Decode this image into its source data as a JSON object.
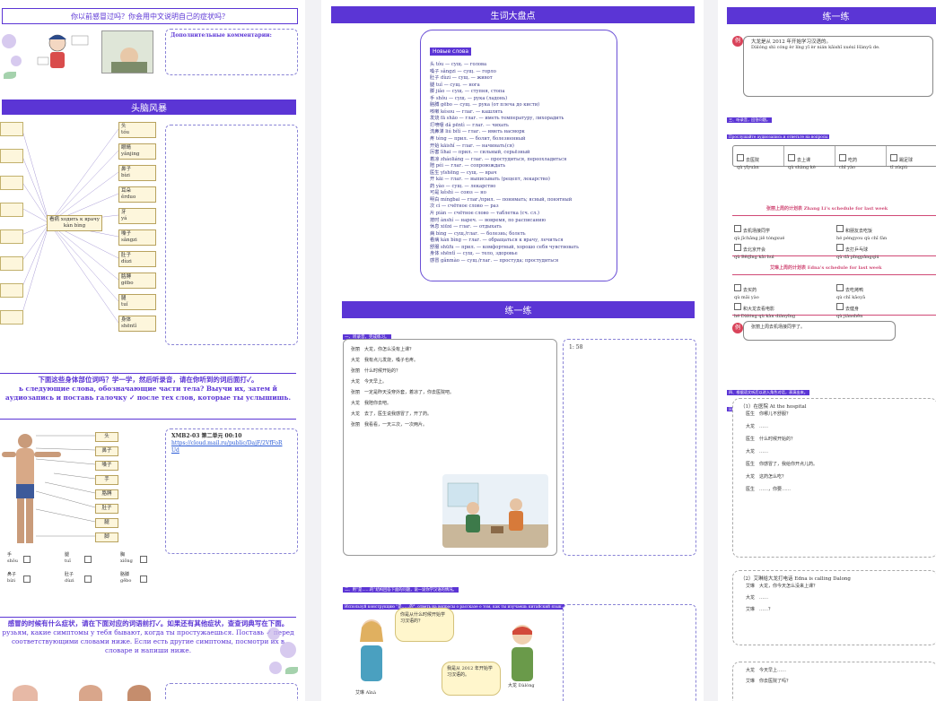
{
  "page1": {
    "question_heading": "你以前感冒过吗？你会用中文说明自己的症状吗？",
    "comments_label": "Дополнительные комментарии:",
    "brainstorm_heading": "头脑风暴",
    "center_label_cn": "看病 ходить к врачу",
    "center_label_py": "kàn bìng",
    "body_parts": [
      {
        "cn": "头",
        "py": "tóu"
      },
      {
        "cn": "眼睛",
        "py": "yǎnjing"
      },
      {
        "cn": "鼻子",
        "py": "bízi"
      },
      {
        "cn": "耳朵",
        "py": "ěrduo"
      },
      {
        "cn": "牙",
        "py": "yá"
      },
      {
        "cn": "嗓子",
        "py": "sǎngzi"
      },
      {
        "cn": "肚子",
        "py": "dùzi"
      },
      {
        "cn": "胳膊",
        "py": "gēbo"
      },
      {
        "cn": "腿",
        "py": "tuǐ"
      },
      {
        "cn": "身体",
        "py": "shēntǐ"
      }
    ],
    "task1_cn": "下面这些身体部位词吗？学一学，然后听录音，请在你听到的词后面打✓。",
    "task1_ru": "ь следующие слова, обозначающие части тела? Выучи их, затем й аудиозапись и поставь галочку ✓ после тех слов, которые ты услышишь.",
    "audio_ref": "XMB2-03 第二单元 00:10",
    "audio_link": "https://cloud.mail.ru/public/DajF/2VfFoR Ud",
    "figure_labels": [
      "头",
      "鼻子",
      "嗓子",
      "手",
      "胳膊",
      "肚子",
      "腿",
      "脚"
    ],
    "bottom_words": [
      {
        "cn": "手",
        "py": "shǒu"
      },
      {
        "cn": "腿",
        "py": "tuǐ"
      },
      {
        "cn": "胸",
        "py": "xiōng"
      },
      {
        "cn": "鼻子",
        "py": "bízi"
      },
      {
        "cn": "肚子",
        "py": "dùzi"
      },
      {
        "cn": "胳膊",
        "py": "gēbo"
      }
    ],
    "task2_cn": "感冒的时候有什么症状，请在下面对应的词语前打✓。如果还有其他症状，查查词典写在下面。",
    "task2_ru": "рузьям, какие симптомы у тебя бывают, когда ты простужаешься. Поставь ✓ перед соответствующими словами ниже. Если есть другие симптомы, посмотри их в словаре и напиши ниже."
  },
  "page2": {
    "vocab_heading": "生词大盘点",
    "new_words_label": "Новые слова",
    "vocab": [
      "头 tóu — сущ. — голова",
      "嗓子 sǎngzi — сущ. — горло",
      "肚子 dùzi — сущ. — живот",
      "腿 tuǐ — сущ. — нога",
      "脚 jiǎo — сущ. — ступня, стопа",
      "手 shǒu — сущ. — рука (ладонь)",
      "胳膊 gēbo — сущ. — рука (от плеча до кисти)",
      "咳嗽 késou — глаг. — кашлять",
      "发烧 fā shāo — глаг. — иметь температуру, лихорадить",
      "打喷嚏 dǎ pēntì — глаг. — чихать",
      "流鼻涕 liú bítì — глаг. — иметь насморк",
      "疼 téng — прил. — болит, болезненный",
      "开始 kāishǐ — глаг. — начинать(ся)",
      "厉害 lìhai — прил. — сильный, серьёзный",
      "着凉 zháoliáng — глаг. — простудиться, переохладиться",
      "陪 péi — глаг. — сопровождать",
      "医生 yīshēng — сущ. — врач",
      "开 kāi — глаг. — выписывать (рецепт, лекарство)",
      "药 yào — сущ. — лекарство",
      "可是 kěshì — союз — но",
      "明白 míngbai — глаг./прил. — понимать; ясный, понятный",
      "次 cì — счётное слово — раз",
      "片 piàn — счётное слово — таблетка (сч. сл.)",
      "按时 ànshí — нареч. — вовремя, по расписанию",
      "休息 xiūxi — глаг. — отдыхать",
      "病 bìng — сущ./глаг. — болезнь; болеть",
      "看病 kàn bìng — глаг. — обращаться к врачу, лечиться",
      "舒服 shūfu — прил. — комфортный, хорошо себя чувствовать",
      "身体 shēntǐ — сущ. — тело, здоровье",
      "感冒 gǎnmào — сущ./глаг. — простуда; простудиться"
    ],
    "exercise_heading": "练一练",
    "ex1_cn": "一、听录音，完成练习。",
    "ex1_ru": "Чжан Ли и Дачун разговаривают дома.",
    "dialog": [
      {
        "spk": "张丽",
        "cn": "大龙，你怎么没有上课？"
      },
      {
        "spk": "大龙",
        "cn": "我有点儿发烧，嗓子也疼。"
      },
      {
        "spk": "张丽",
        "cn": "什么时候开始的？"
      },
      {
        "spk": "大龙",
        "cn": "今天早上。"
      },
      {
        "spk": "张丽",
        "cn": "一定是昨天没穿外套，着凉了，你去医院吧。"
      },
      {
        "spk": "大龙",
        "cn": "我陪你去吧。"
      },
      {
        "spk": "大龙",
        "cn": "去了，医生说我感冒了，开了药。"
      },
      {
        "spk": "张丽",
        "cn": "我看看，一天三次，一次两片。"
      }
    ],
    "audio_time": "1: 58",
    "ex2_cn": "二、用“是……的”结构回答下面的问题，说一说你学汉语的情况。",
    "ex2_ru": "Используй конструкцию \"是……的\", ответь на вопросы о рассказе о том, как ты изучаешь китайский язык.",
    "bubble1": "你是从什么时候开始学习汉语的？",
    "bubble2": "我是从 2012 年开始学习汉语的。",
    "name_left": "艾琳 Aīnà",
    "name_right": "大龙 Dàlóng"
  },
  "page3": {
    "exercise_heading": "练一练",
    "ex_num": "例",
    "example_cn": "大龙是从 2012 年开始学习汉语的。",
    "example_py": "Dàlóng shì cóng èr líng yī èr nián kāishǐ xuéxí Hànyǔ de.",
    "ex3_cn": "三、听录音，回答问题。",
    "ex3_ru": "Прослушайте аудиозапись и ответьте на вопросы",
    "activities1": [
      {
        "cn": "去医院",
        "py": "qù yīyuàn"
      },
      {
        "cn": "去上课",
        "py": "qù shàng kè"
      },
      {
        "cn": "吃药",
        "py": "chī yào"
      },
      {
        "cn": "踢足球",
        "py": "tī zúqiú"
      }
    ],
    "schedule1_title": "张丽上周的计划表 Zhang Li's schedule for last week",
    "schedule1": [
      {
        "cn": "去机场接同学",
        "py": "qù jīchǎng jiē tóngxué"
      },
      {
        "cn": "和朋友去吃饭",
        "py": "hé péngyou qù chī fàn"
      },
      {
        "cn": "去北京开会",
        "py": "qù Běijīng kāi huì"
      },
      {
        "cn": "去打乒乓球",
        "py": "qù dǎ pīngpāngqiú"
      }
    ],
    "schedule2_title": "艾琳上周的计划表 Edna's schedule for last week",
    "schedule2": [
      {
        "cn": "去买药",
        "py": "qù mǎi yào"
      },
      {
        "cn": "去吃烤鸭",
        "py": "qù chī kǎoyā"
      },
      {
        "cn": "和大龙去看电影",
        "py": "hé Dàlóng qù kàn diànyǐng"
      },
      {
        "cn": "去健身",
        "py": "qù jiànshēn"
      }
    ],
    "example2": "张丽上周去机场接同学了。",
    "ex4_cn": "四、根据语文听后以进入角色对话，表演出来。",
    "ex4_ru": "На основе информации, данной в тексте урока, составь диалог и разыграй его.",
    "sec1": "（1）在医院 At the hospital",
    "sec1_lines": [
      {
        "spk": "医生",
        "cn": "你哪儿不舒服？"
      },
      {
        "spk": "大龙",
        "cn": "……"
      },
      {
        "spk": "医生",
        "cn": "什么时候开始的？"
      },
      {
        "spk": "大龙",
        "cn": "……"
      },
      {
        "spk": "医生",
        "cn": "你感冒了，我给你开点儿药。"
      },
      {
        "spk": "大龙",
        "cn": "这药怎么吃？"
      },
      {
        "spk": "医生",
        "cn": "……，你要……"
      }
    ],
    "sec2": "（2）艾琳给大龙打电话 Edna is calling Dalong",
    "sec2_lines": [
      {
        "spk": "艾琳",
        "cn": "大龙，你今天怎么没来上课？"
      },
      {
        "spk": "大龙",
        "cn": "……"
      },
      {
        "spk": "艾琳",
        "cn": "……？"
      }
    ],
    "sec3_lines": [
      {
        "spk": "大龙",
        "cn": "今天早上……"
      },
      {
        "spk": "艾琳",
        "cn": "你去医院了吗？"
      }
    ]
  }
}
